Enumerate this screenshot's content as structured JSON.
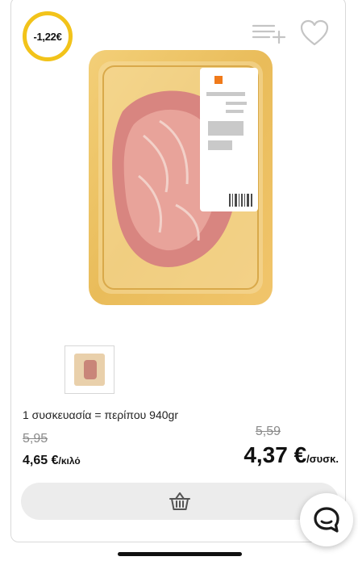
{
  "badge": {
    "discount": "-1,22€",
    "color": "#f2c31a"
  },
  "header_icons": [
    "add-to-list-icon",
    "heart-icon"
  ],
  "product": {
    "package_info": "1 συσκευασία = περίπου 940gr",
    "old_price_per_kilo": "5,95",
    "price_per_kilo": "4,65 €",
    "price_per_kilo_unit": "/κιλό",
    "old_price_per_pack": "5,59",
    "price_per_pack": "4,37 €",
    "price_per_pack_unit": "/συσκ."
  },
  "actions": {
    "cart_icon": "basket-icon",
    "chat_icon": "chat-bubble-icon"
  }
}
